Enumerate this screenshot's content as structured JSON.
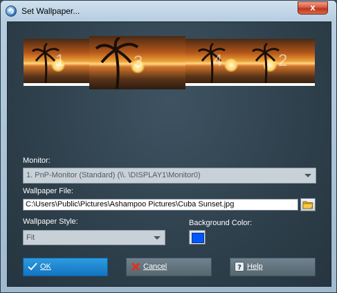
{
  "window": {
    "title": "Set Wallpaper..."
  },
  "titlebar": {
    "close_label": "x"
  },
  "preview": {
    "monitors": [
      {
        "number": "1"
      },
      {
        "number": "3"
      },
      {
        "number": "4"
      },
      {
        "number": "2"
      }
    ]
  },
  "form": {
    "monitor_label": "Monitor:",
    "monitor_value": "1. PnP-Monitor (Standard) (\\\\. \\DISPLAY1\\Monitor0)",
    "wallpaper_file_label": "Wallpaper File:",
    "wallpaper_file_value": "C:\\Users\\Public\\Pictures\\Ashampoo Pictures\\Cuba Sunset.jpg",
    "wallpaper_style_label": "Wallpaper Style:",
    "wallpaper_style_value": "Fit",
    "background_color_label": "Background Color:",
    "background_color": "#0055ff"
  },
  "buttons": {
    "ok_label": "OK",
    "cancel_label": "Cancel",
    "help_label": "Help"
  }
}
